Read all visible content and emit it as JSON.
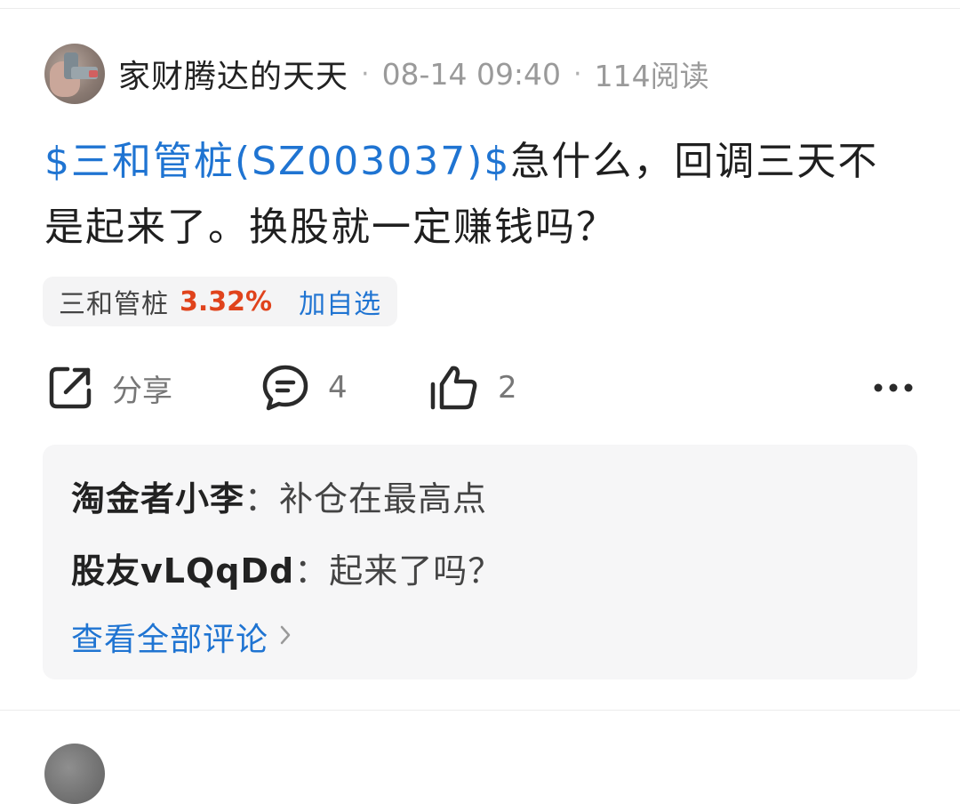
{
  "post": {
    "author": "家财腾达的天天",
    "date": "08-14 09:40",
    "reads": "114阅读",
    "stock_tag": "$三和管桩(SZ003037)$",
    "content": "急什么，回调三天不是起来了。换股就一定赚钱吗？"
  },
  "stock_chip": {
    "name": "三和管桩",
    "change": "3.32%",
    "add_label": "加自选"
  },
  "actions": {
    "share_label": "分享",
    "comment_count": "4",
    "like_count": "2"
  },
  "comments": [
    {
      "user": "淘金者小李",
      "separator": "：",
      "text": "补仓在最高点"
    },
    {
      "user": "股友vLQqDd",
      "separator": "：",
      "text": "起来了吗？"
    }
  ],
  "view_all": "查看全部评论",
  "colors": {
    "link_blue": "#1f74d2",
    "rise_red": "#e0431c"
  }
}
